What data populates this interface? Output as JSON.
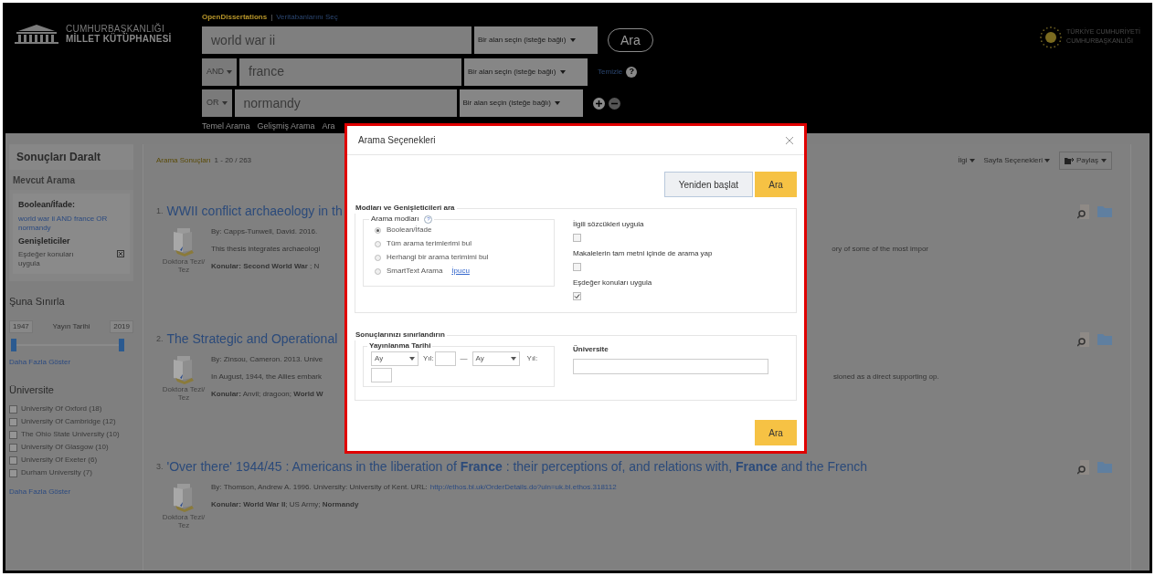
{
  "header": {
    "logo_lines": [
      "CUMHURBAŞKANLIĞI",
      "MİLLET KÜTÜPHANESİ"
    ],
    "source_tabs": [
      {
        "label": "OpenDissertations",
        "selected": true
      },
      {
        "label": "Veritabanlarını Seç",
        "selected": false
      }
    ],
    "separator": "|",
    "search_rows": [
      {
        "query": "world war ii",
        "field": "Bir alan seçin (isteğe bağlı)"
      },
      {
        "operator": "AND",
        "query": "france",
        "field": "Bir alan seçin (isteğe bağlı)"
      },
      {
        "operator": "OR",
        "query": "normandy",
        "field": "Bir alan seçin (isteğe bağlı)"
      }
    ],
    "search_button": "Ara",
    "clear_link": "Temizle",
    "help": "?",
    "links": [
      "Temel Arama",
      "Gelişmiş Arama",
      "Ara"
    ],
    "emblem_lines": [
      "TÜRKİYE CUMHURİYETİ",
      "CUMHURBAŞKANLIĞI"
    ]
  },
  "sidebar": {
    "title": "Sonuçları Daralt",
    "current_search": {
      "title": "Mevcut Arama",
      "boolean_label": "Boolean/İfade:",
      "query_link": "world war ii AND france OR normandy",
      "expanders_label": "Genişleticiler",
      "expander": "Eşdeğer konuları uygula"
    },
    "limit": {
      "title": "Şuna Sınırla",
      "from": "1947",
      "label": "Yayın Tarihi",
      "to": "2019",
      "thumbs": [
        {
          "level": 0
        },
        {
          "level": 1
        }
      ],
      "more": "Daha Fazla Göster"
    },
    "university": {
      "title": "Üniversite",
      "items": [
        {
          "label": "University Of Oxford (18)",
          "checked": false
        },
        {
          "label": "University Of Cambridge (12)",
          "checked": false
        },
        {
          "label": "The Ohio State University (10)",
          "checked": false
        },
        {
          "label": "University Of Glasgow (10)",
          "checked": false
        },
        {
          "label": "University Of Exeter (6)",
          "checked": false
        },
        {
          "label": "Durham University (7)",
          "checked": false
        }
      ],
      "more": "Daha Fazla Göster"
    }
  },
  "results": {
    "label": "Arama Sonuçları",
    "count": "1 - 20 / 263",
    "sort": "İlgi",
    "page_options": "Sayfa Seçenekleri",
    "share": "Paylaş",
    "items": [
      {
        "number": "1.",
        "title": "WWII conflict archaeology in th",
        "byline": "By: Capps-Tunwell, David. 2016.",
        "abstract": "This thesis integrates archaeologi",
        "abstract_right": "ory of some of the most impor",
        "subjects": "**Konular:** **Second World War** ; N",
        "type": "Doktora Tezi/ Tez"
      },
      {
        "number": "2.",
        "title": "The Strategic and Operational",
        "byline": "By: Zinsou, Cameron. 2013. Unive",
        "abstract": "In August, 1944, the Allies embark",
        "abstract_right": "sioned as a direct supporting op.",
        "subjects": "**Konular:** Anvil; dragoon; **World W**",
        "type": "Doktora Tezi/ Tez"
      },
      {
        "number": "3.",
        "title": "'Over there' 1944/45 : Americans in the liberation of **France** : their perceptions of, and relations with, **France** and the French",
        "byline": "By: Thomson, Andrew A. 1996. University: University of Kent. URL:",
        "url": "http://ethos.bl.uk/OrderDetails.do?uin=uk.bl.ethos.318112",
        "subjects": "**Konular:** **World War II**; US Army; **Normandy**",
        "type": "Doktora Tezi/ Tez"
      }
    ]
  },
  "dialog": {
    "title": "Arama Seçenekleri",
    "reset_button": "Yeniden başlat",
    "search_button": "Ara",
    "modes_section": {
      "legend": "Modları ve Genişleticileri ara",
      "modes_legend": "Arama modları",
      "help": "?",
      "modes": [
        {
          "label": "Boolean/İfade",
          "selected": true
        },
        {
          "label": "Tüm arama terimlerimi bul",
          "selected": false
        },
        {
          "label": "Herhangi bir arama terimimi bul",
          "selected": false
        },
        {
          "label": "SmartText Arama",
          "selected": false,
          "link": "İpucu"
        }
      ],
      "options": [
        {
          "label": "İlgili sözcükleri uygula",
          "checked": false
        },
        {
          "label": "Makalelerin tam metni içinde de arama yap",
          "checked": false
        },
        {
          "label": "Eşdeğer konuları uygula",
          "checked": true
        }
      ]
    },
    "limit_section": {
      "legend": "Sonuçlarınızı sınırlandırın",
      "date_legend": "Yayınlanma Tarihi",
      "month_from": "Ay",
      "year_label": "Yıl:",
      "dash": "—",
      "month_to": "Ay",
      "year_label_2": "Yıl:",
      "university_label": "Üniversite"
    },
    "bottom_button": "Ara"
  }
}
